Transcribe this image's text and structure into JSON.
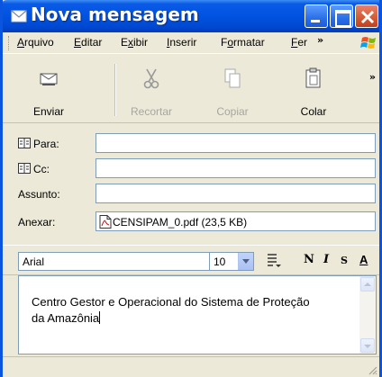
{
  "window": {
    "title": "Nova mensagem"
  },
  "menu": {
    "items": [
      {
        "label": "Arquivo",
        "accel": "A",
        "rest": "rquivo"
      },
      {
        "label": "Editar",
        "accel": "E",
        "rest": "ditar"
      },
      {
        "label": "Exibir",
        "pre": "E",
        "accel": "x",
        "rest": "ibir"
      },
      {
        "label": "Inserir",
        "accel": "I",
        "rest": "nserir"
      },
      {
        "label": "Formatar",
        "pre": "F",
        "accel": "o",
        "rest": "rmatar"
      },
      {
        "label": "Fer",
        "accel": "F",
        "rest": "er"
      }
    ],
    "overflow": "»"
  },
  "toolbar": {
    "send_label": "Enviar",
    "cut_label": "Recortar",
    "copy_label": "Copiar",
    "paste_label": "Colar",
    "overflow": "»"
  },
  "fields": {
    "to_label": "Para:",
    "to_value": "",
    "cc_label": "Cc:",
    "cc_value": "",
    "subject_label": "Assunto:",
    "subject_value": "",
    "attach_label": "Anexar:",
    "attachment": "CENSIPAM_0.pdf (23,5 KB)"
  },
  "format": {
    "font": "Arial",
    "size": "10",
    "bold": "N",
    "italic": "I",
    "underline": "S",
    "color": "A"
  },
  "message": {
    "line1": "Centro Gestor e Operacional do Sistema de Proteção",
    "line2": "da Amazônia"
  },
  "colors": {
    "titlebar": "#0053e0",
    "frame": "#ece9d8",
    "close_button": "#d25a32"
  }
}
